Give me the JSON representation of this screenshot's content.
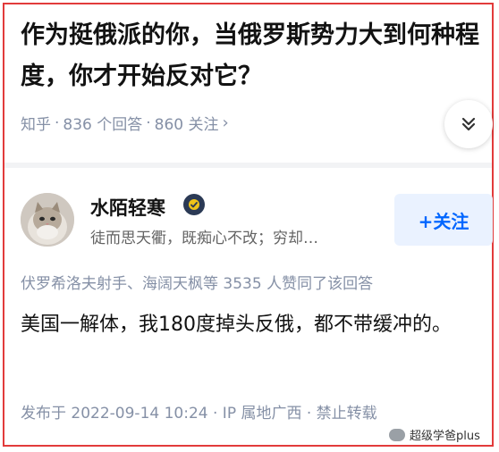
{
  "question": {
    "title": "作为挺俄派的你，当俄罗斯势力大到何种程度，你才开始反对它？",
    "source": "知乎",
    "answers": "836 个回答",
    "followers": "860 关注"
  },
  "author": {
    "name": "水陌轻寒",
    "bio": "徒而思天衢，既痴心不改；穷却…",
    "follow_label": "+关注"
  },
  "answer": {
    "voters": "伏罗希洛夫射手、海阔天枫等 3535 人赞同了该回答",
    "body": "美国一解体，我180度掉头反俄，都不带缓冲的。",
    "published": "发布于 2022-09-14 10:24 · IP 属地广西 · 禁止转载"
  },
  "watermark": "超级学爸plus",
  "colors": {
    "border": "#e23b3b",
    "accent": "#0066ff",
    "meta": "#8590a6"
  },
  "icons": {
    "collapse": "double-chevron-down-icon",
    "badge": "verified-badge-icon",
    "chevron": "chevron-right-icon"
  }
}
